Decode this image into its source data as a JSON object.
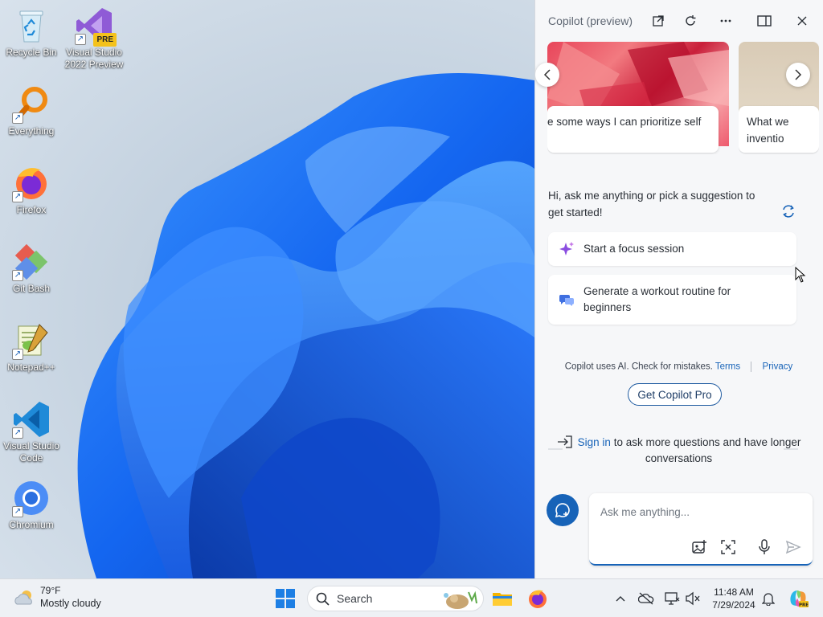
{
  "desktop": {
    "icons": [
      {
        "label": "Recycle Bin",
        "icon": "recycle-bin-icon"
      },
      {
        "label": "Visual Studio 2022 Preview",
        "icon": "visual-studio-preview-icon",
        "badge": "PRE"
      },
      {
        "label": "Everything",
        "icon": "everything-search-icon"
      },
      {
        "label": "Firefox",
        "icon": "firefox-icon"
      },
      {
        "label": "Git Bash",
        "icon": "git-bash-icon"
      },
      {
        "label": "Notepad++",
        "icon": "notepad-plus-plus-icon"
      },
      {
        "label": "Visual Studio Code",
        "icon": "vscode-icon"
      },
      {
        "label": "Chromium",
        "icon": "chromium-icon"
      }
    ]
  },
  "copilot": {
    "title": "Copilot (preview)",
    "header_buttons": [
      "open-in-new-icon",
      "refresh-icon",
      "more-icon",
      "split-view-icon",
      "close-icon"
    ],
    "carousel": {
      "cards": [
        {
          "caption": "e some ways I can prioritize self"
        },
        {
          "caption_line1": "What we",
          "caption_line2": "inventio"
        }
      ]
    },
    "greeting": "Hi, ask me anything or pick a suggestion to get started!",
    "suggestions": [
      {
        "label": "Start a focus session",
        "icon": "sparkle-icon"
      },
      {
        "label": "Generate a workout routine for beginners",
        "icon": "chat-bubbles-icon"
      }
    ],
    "disclaimer": {
      "text": "Copilot uses AI. Check for mistakes.",
      "terms": "Terms",
      "privacy": "Privacy"
    },
    "pro_button": "Get Copilot Pro",
    "signin": {
      "link": "Sign in",
      "rest": "to ask more questions and have longer conversations"
    },
    "input": {
      "placeholder": "Ask me anything..."
    }
  },
  "taskbar": {
    "weather_temp": "79°F",
    "weather_desc": "Mostly cloudy",
    "search_label": "Search",
    "time": "11:48 AM",
    "date": "7/29/2024"
  },
  "colors": {
    "accent": "#1763b8",
    "bloom": "#1a6cf0"
  }
}
